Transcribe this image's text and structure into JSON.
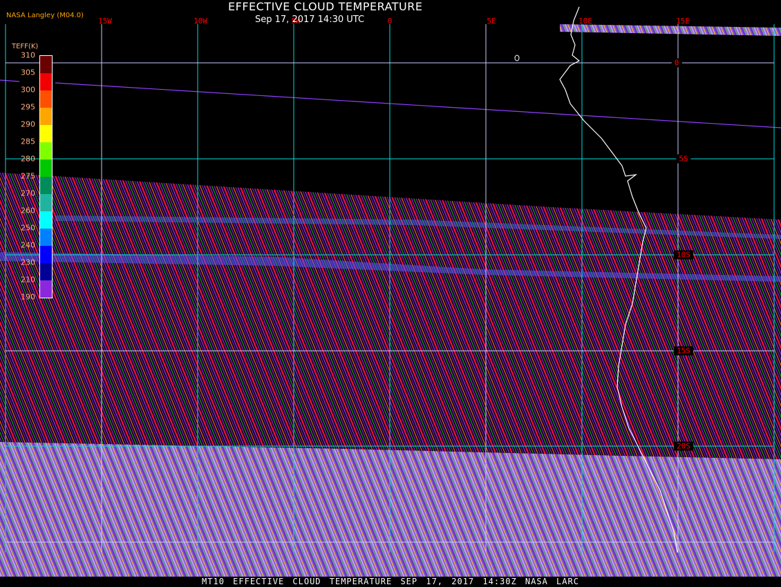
{
  "header": {
    "title": "EFFECTIVE CLOUD TEMPERATURE",
    "subtitle": "Sep 17, 2017 14:30 UTC",
    "brand": "NASA Langley (M04.0)"
  },
  "longitudes": [
    "15W",
    "10W",
    "5W",
    "0",
    "5E",
    "10E",
    "15E"
  ],
  "latitudes": [
    "0",
    "5S",
    "10S",
    "15S",
    "20S"
  ],
  "legend": {
    "title": "TEFF(K)",
    "labels": [
      "310",
      "305",
      "300",
      "295",
      "290",
      "285",
      "280",
      "275",
      "270",
      "260",
      "250",
      "240",
      "230",
      "210",
      "190"
    ],
    "colors": [
      "#6a0000",
      "#f00000",
      "#ff5000",
      "#ffa500",
      "#ffff00",
      "#80ff00",
      "#00c800",
      "#008c5a",
      "#20b4a0",
      "#00ffff",
      "#0080ff",
      "#0000ff",
      "#000096",
      "#8c28dc"
    ]
  },
  "footer": "MT10  EFFECTIVE CLOUD TEMPERATURE   SEP 17, 2017 14:30Z   NASA LARC"
}
